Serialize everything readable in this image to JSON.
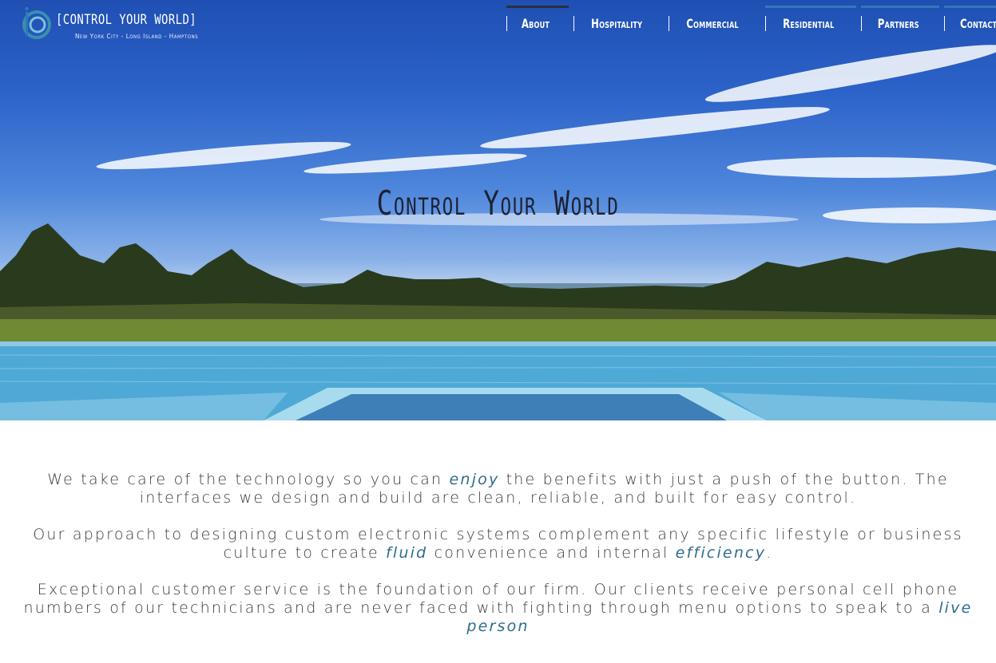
{
  "brand": {
    "title": "[CONTROL YOUR WORLD]",
    "tagline": "New York City - Long Island - Hamptons",
    "logo_icon": "icc-logo-icon",
    "accent": "#2f6c8f"
  },
  "nav": {
    "items": [
      {
        "label": "About",
        "bar": "#2a2f3a"
      },
      {
        "label": "Hospitality",
        "bar": ""
      },
      {
        "label": "Commercial",
        "bar": ""
      },
      {
        "label": "Residential",
        "bar": "#2f79b8"
      },
      {
        "label": "Partners",
        "bar": "#2f79b8"
      },
      {
        "label": "Contact",
        "bar": "#2f79b8"
      }
    ]
  },
  "hero": {
    "title": "Control Your World"
  },
  "intro": {
    "p1": {
      "a": "We take care of the technology so you can ",
      "em1": "enjoy",
      "b": " the benefits with just a push of the button. The interfaces we design and build are clean, reliable, and built for easy control."
    },
    "p2": {
      "a": "Our approach to designing custom electronic systems complement any specific lifestyle or business culture to create ",
      "em1": "fluid",
      "b": " convenience and internal ",
      "em2": "efficiency",
      "c": "."
    },
    "p3": {
      "a": "Exceptional customer service is the foundation of our firm. Our clients receive personal cell phone numbers of our technicians and are never faced with fighting through menu options to speak to a ",
      "em1": "live person",
      "b": ""
    }
  }
}
